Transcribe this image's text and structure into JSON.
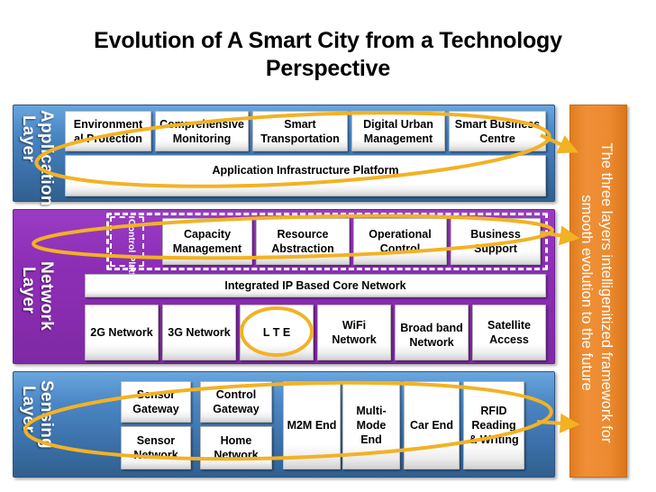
{
  "title": "Evolution of A Smart City from a Technology Perspective",
  "colors": {
    "application_layer": "#4a86c4",
    "network_layer": "#8d2fb6",
    "sensing_layer": "#4a86c4",
    "banner": "#ec8a2f",
    "highlight_ellipse": "#f2b224",
    "box_fill": "#ffffff"
  },
  "layers": [
    {
      "id": "application",
      "label": "Application Layer",
      "label_lines": [
        "Application",
        "Layer"
      ],
      "boxes": [
        "Environment al Protection",
        "Comprehensive Monitoring",
        "Smart Transportation",
        "Digital Urban Management",
        "Smart Business Centre"
      ],
      "platform": "Application Infrastructure Platform"
    },
    {
      "id": "network",
      "label": "Network Layer",
      "label_lines": [
        "Network",
        "Layer"
      ],
      "control_platform": "Control Platform",
      "control_boxes": [
        "Capacity Management",
        "Resource Abstraction",
        "Operational Control",
        "Business Support"
      ],
      "core_network": "Integrated IP Based Core Network",
      "access_boxes": [
        "2G Network",
        "3G Network",
        "L T E",
        "WiFi Network",
        "Broad band Network",
        "Satellite Access"
      ],
      "highlighted_access": "L T E"
    },
    {
      "id": "sensing",
      "label": "Sensing Layer",
      "label_lines": [
        "Sensing",
        "Layer"
      ],
      "column_pairs": [
        {
          "top": "Sensor Gateway",
          "bottom": "Sensor Network"
        },
        {
          "top": "Control Gateway",
          "bottom": "Home Network"
        }
      ],
      "tall_boxes": [
        "M2M End",
        "Multi- Mode End",
        "Car End",
        "RFID Reading & Writing"
      ]
    }
  ],
  "banner": {
    "text": "The three layers intelligenitized framework for smooth evolution to the future"
  },
  "annotations": {
    "ellipse_application": "highlight-ellipse-application",
    "ellipse_network": "highlight-ellipse-network",
    "ellipse_sensing": "highlight-ellipse-sensing",
    "ellipse_lte": "highlight-ellipse-lte"
  }
}
